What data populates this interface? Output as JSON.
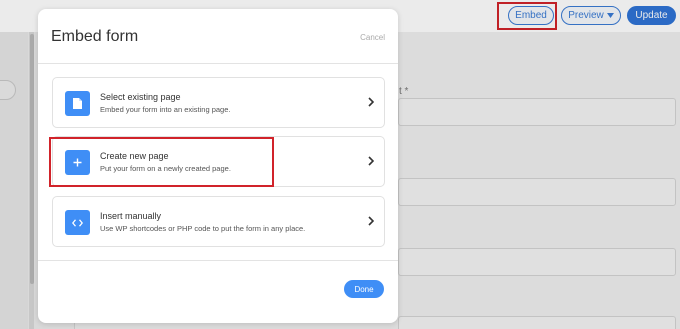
{
  "topbar": {
    "embed_label": "Embed",
    "preview_label": "Preview",
    "update_label": "Update"
  },
  "background": {
    "required_mark": "t *"
  },
  "modal": {
    "title": "Embed form",
    "cancel_label": "Cancel",
    "done_label": "Done",
    "options": [
      {
        "icon": "page-icon",
        "title": "Select existing page",
        "description": "Embed your form into an existing page."
      },
      {
        "icon": "plus-icon",
        "title": "Create new page",
        "description": "Put your form on a newly created page."
      },
      {
        "icon": "code-icon",
        "title": "Insert manually",
        "description": "Use WP shortcodes or PHP code to put the form in any place."
      }
    ]
  },
  "colors": {
    "accent": "#3f8ef6",
    "highlight": "#d1232a"
  }
}
